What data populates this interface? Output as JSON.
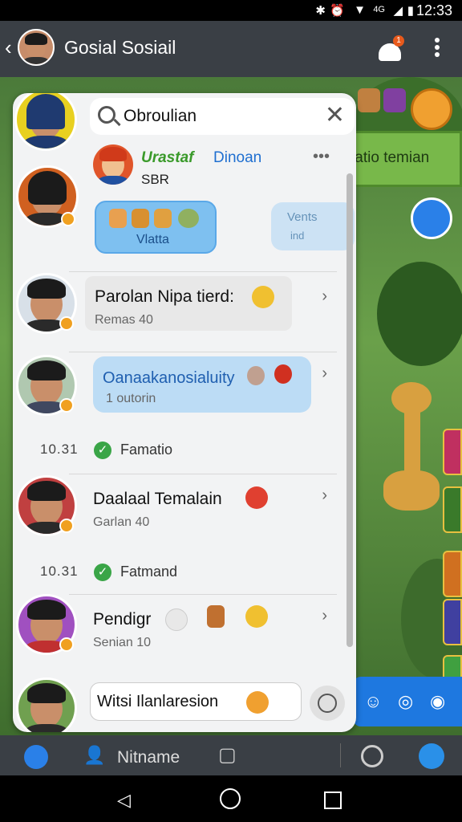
{
  "status_bar": {
    "time": "12:33"
  },
  "app_bar": {
    "title": "Gosial Sosiail",
    "notification_count": "1"
  },
  "game": {
    "right_pill_label": "tatio temian"
  },
  "search": {
    "value": "Obroulian"
  },
  "header_contact": {
    "name_green": "Urastaf",
    "name_blue": "Dinoan",
    "subtitle": "SBR",
    "bubble_left_caption": "Vlatta",
    "bubble_right_top": "Vents",
    "bubble_right_bottom": "ind"
  },
  "contacts": [
    {
      "name": "Parolan Nipa tierd:",
      "sub": "Remas 40"
    },
    {
      "name": "Oanaakanosialuity",
      "sub": "1 outorin"
    },
    {
      "name": "Daalaal Temalain",
      "sub": "Garlan 40"
    },
    {
      "name": "Pendigr",
      "sub": "Senian 10"
    }
  ],
  "system_messages": [
    {
      "time": "10.31",
      "text": "Famatio"
    },
    {
      "time": "10.31",
      "text": "Fatmand"
    }
  ],
  "compose": {
    "value": "Witsi Ilanlaresion"
  },
  "bottom_bar": {
    "label": "Nitname"
  }
}
